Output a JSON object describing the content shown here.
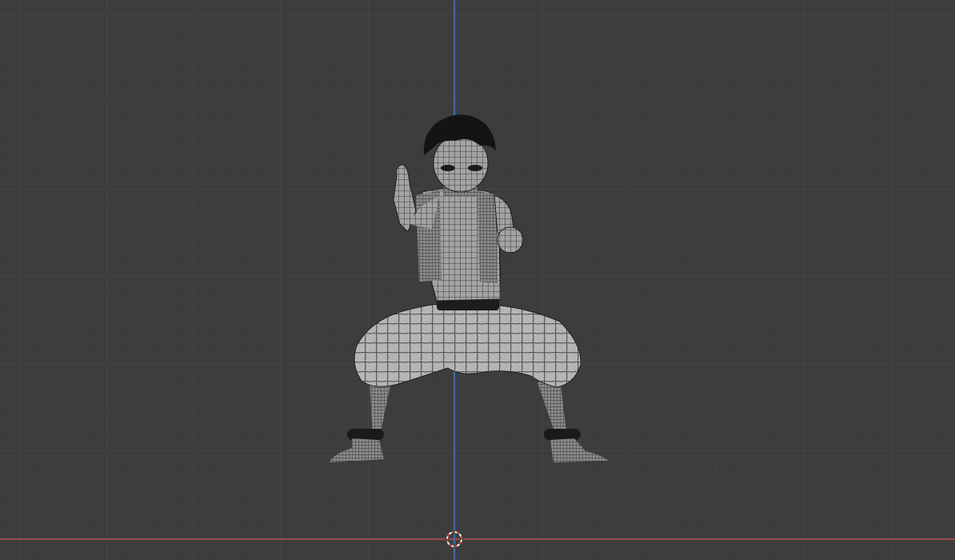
{
  "viewport": {
    "background_color": "#3d3d3d",
    "grid_major_color": "#464646",
    "grid_minor_color": "#3a3a3a"
  },
  "axes": {
    "z_axis_color": "#3f6aa6",
    "x_axis_color": "#9a4a4a"
  },
  "cursor": {
    "ring_color_primary": "#e04a3a",
    "ring_color_secondary": "#ffffff",
    "icon": "3d-cursor-icon"
  },
  "model": {
    "icon": "character-mesh-icon",
    "mesh_fill": "#9a9a9a",
    "wire_color": "#1e1e1e",
    "hair_color": "#141414"
  }
}
